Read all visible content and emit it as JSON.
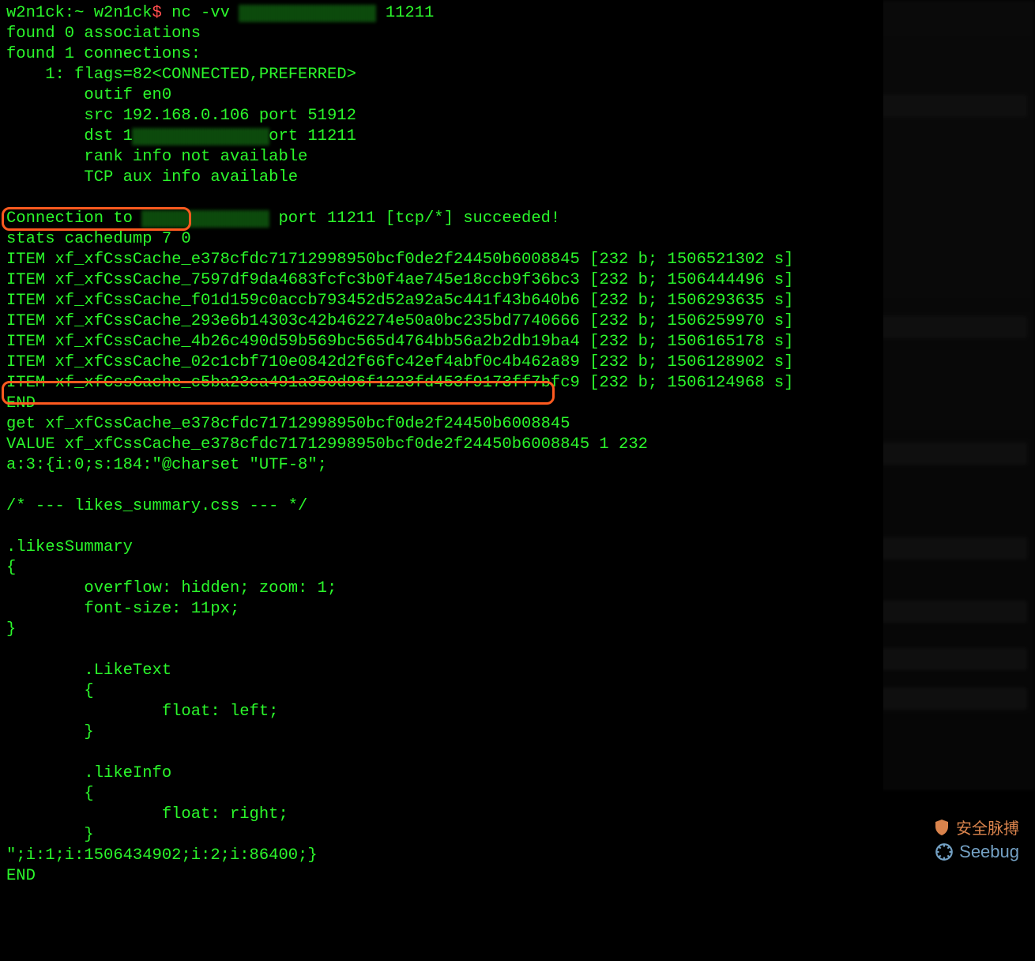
{
  "prompt": {
    "host": "w2n1ck:~ w2n1ck",
    "dollar": "$",
    "command": "nc -vv",
    "port_arg": "11211"
  },
  "nc_output": {
    "l1": "found 0 associations",
    "l2": "found 1 connections:",
    "l3": "    1: flags=82<CONNECTED,PREFERRED>",
    "l4": "        outif en0",
    "l5_a": "        src 192.168.0.106 port 51912",
    "l6_a": "        dst 1",
    "l6_b": "ort 11211",
    "l7": "        rank info not available",
    "l8": "        TCP aux info available",
    "blank": "",
    "conn_a": "Connection to ",
    "conn_b": " port 11211 [tcp/*] succeeded!"
  },
  "cmd1": "stats cachedump 7 0",
  "items": [
    "ITEM xf_xfCssCache_e378cfdc71712998950bcf0de2f24450b6008845 [232 b; 1506521302 s]",
    "ITEM xf_xfCssCache_7597df9da4683fcfc3b0f4ae745e18ccb9f36bc3 [232 b; 1506444496 s]",
    "ITEM xf_xfCssCache_f01d159c0accb793452d52a92a5c441f43b640b6 [232 b; 1506293635 s]",
    "ITEM xf_xfCssCache_293e6b14303c42b462274e50a0bc235bd7740666 [232 b; 1506259970 s]",
    "ITEM xf_xfCssCache_4b26c490d59b569bc565d4764bb56a2b2db19ba4 [232 b; 1506165178 s]",
    "ITEM xf_xfCssCache_02c1cbf710e0842d2f66fc42ef4abf0c4b462a89 [232 b; 1506128902 s]",
    "ITEM xf_xfCssCache_c5ba23ca491a350d96f1223fd453f9173ff7bfc9 [232 b; 1506124968 s]"
  ],
  "end1": "END",
  "cmd2": "get xf_xfCssCache_e378cfdc71712998950bcf0de2f24450b6008845",
  "value_line": "VALUE xf_xfCssCache_e378cfdc71712998950bcf0de2f24450b6008845 1 232",
  "css_body": [
    "a:3:{i:0;s:184:\"@charset \"UTF-8\";",
    "",
    "/* --- likes_summary.css --- */",
    "",
    ".likesSummary",
    "{",
    "        overflow: hidden; zoom: 1;",
    "        font-size: 11px;",
    "}",
    "",
    "        .LikeText",
    "        {",
    "                float: left;",
    "        }",
    "",
    "        .likeInfo",
    "        {",
    "                float: right;",
    "        }",
    "\";i:1;i:1506434902;i:2;i:86400;}"
  ],
  "end2": "END",
  "watermark": {
    "seebug": "Seebug",
    "cn": "安全脉搏"
  }
}
